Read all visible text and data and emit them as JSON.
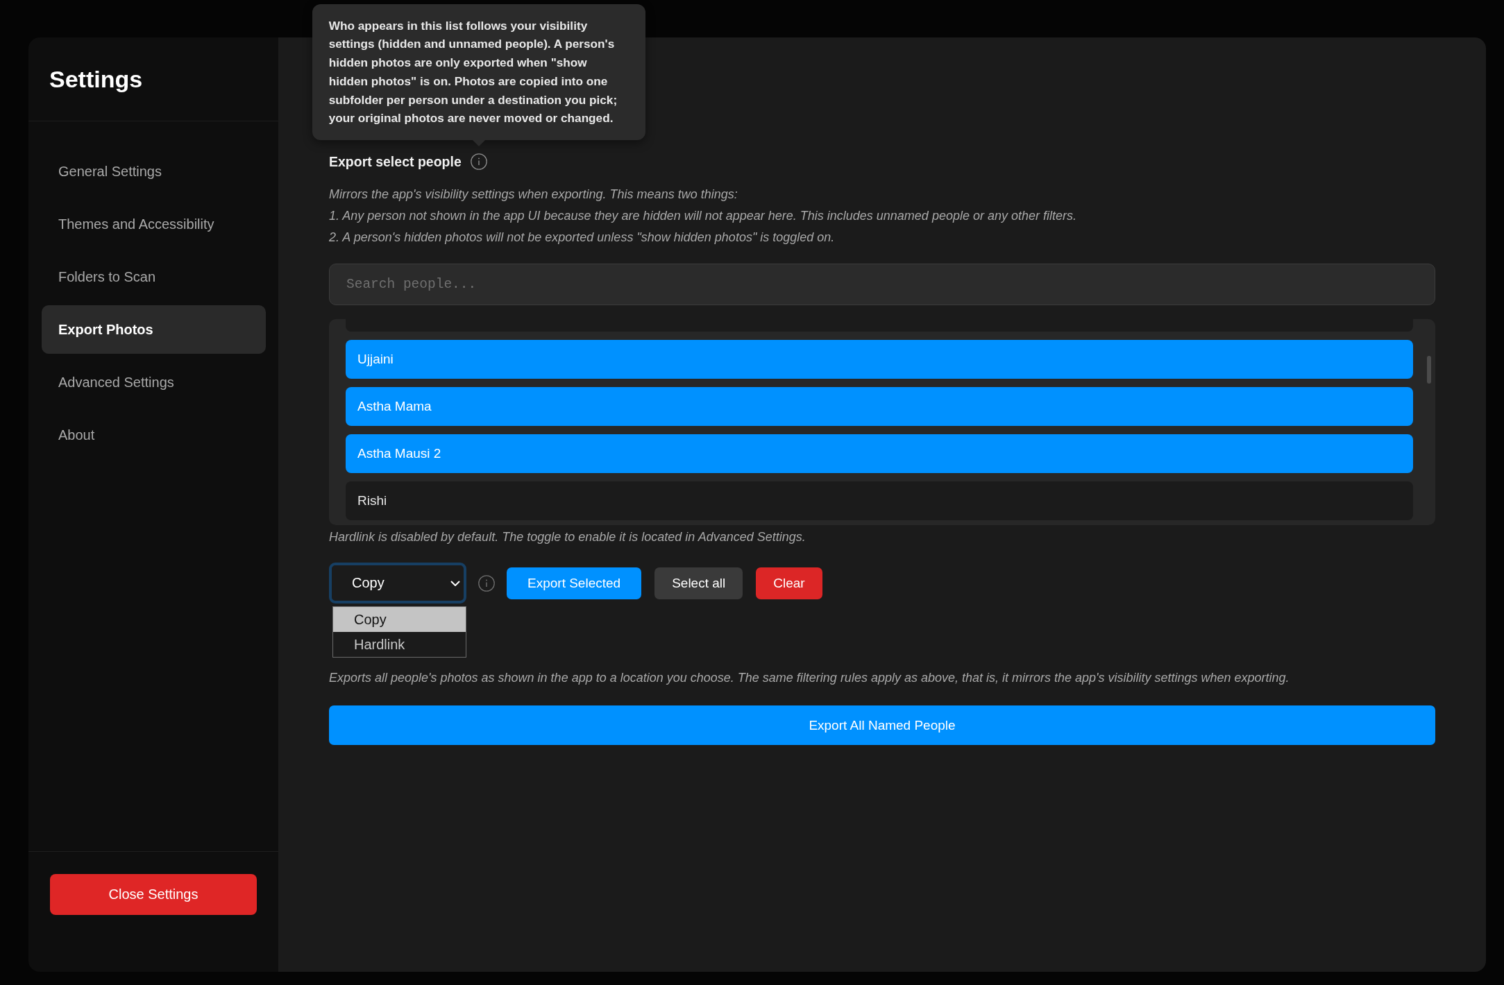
{
  "sidebar": {
    "title": "Settings",
    "items": [
      {
        "label": "General Settings",
        "selected": false
      },
      {
        "label": "Themes and Accessibility",
        "selected": false
      },
      {
        "label": "Folders to Scan",
        "selected": false
      },
      {
        "label": "Export Photos",
        "selected": true
      },
      {
        "label": "Advanced Settings",
        "selected": false
      },
      {
        "label": "About",
        "selected": false
      }
    ],
    "close_button": "Close Settings"
  },
  "export_select": {
    "info_tooltip": "Who appears in this list follows your visibility settings (hidden and unnamed people). A person's hidden photos are only exported when \"show hidden photos\" is on. Photos are copied into one subfolder per person under a destination you pick; your original photos are never moved or changed.",
    "heading": "Export select people",
    "description": [
      "Mirrors the app's visibility settings when exporting. This means two things:",
      "1. Any person not shown in the app UI because they are hidden will not appear here. This includes unnamed people or any other filters.",
      "2. A person's hidden photos will not be exported unless \"show hidden photos\" is toggled on."
    ],
    "search": {
      "placeholder": "Search people..."
    },
    "people": [
      {
        "name": "Ujjaini",
        "selected": true
      },
      {
        "name": "Astha Mama",
        "selected": true
      },
      {
        "name": "Astha Mausi 2",
        "selected": true
      },
      {
        "name": "Rishi",
        "selected": false
      }
    ],
    "hint": "Hardlink is disabled by default. The toggle to enable it is located in Advanced Settings.",
    "mode_select": {
      "value": "Copy",
      "expanded": true,
      "options": [
        {
          "label": "Copy",
          "selected": true
        },
        {
          "label": "Hardlink",
          "selected": false
        }
      ]
    },
    "buttons": [
      {
        "label": "Export Selected",
        "kind": "primary"
      },
      {
        "label": "Select all",
        "kind": "secondary"
      },
      {
        "label": "Clear",
        "kind": "danger"
      }
    ]
  },
  "export_all": {
    "description": "Exports all people's photos as shown in the app to a location you choose. The same filtering rules apply as above, that is, it mirrors the app's visibility settings when exporting.",
    "button": "Export All Named People"
  }
}
